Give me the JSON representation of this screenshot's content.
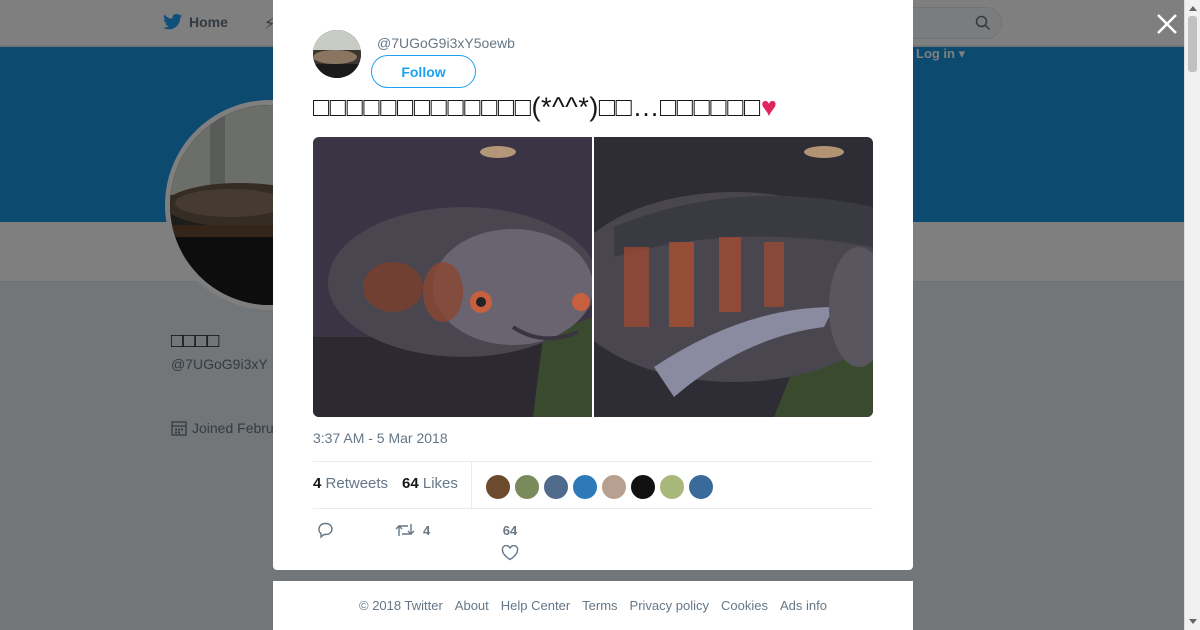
{
  "topbar": {
    "home_label": "Home",
    "login_label": "Log in ▾"
  },
  "profile": {
    "name": "□□□□",
    "handle": "@7UGoG9i3xY",
    "joined": "Joined Febru"
  },
  "tweet": {
    "handle": "@7UGoG9i3xY5oewb",
    "follow_label": "Follow",
    "text": "□□□□□□□□□□□□□(*^^*)□□…□□□□□□",
    "heart": "♥",
    "timestamp": "3:37 AM - 5 Mar 2018",
    "retweets_count": "4",
    "retweets_label": "Retweets",
    "likes_count": "64",
    "likes_label": "Likes",
    "reply_count": "",
    "retweet_action_count": "4",
    "like_action_count": "64",
    "liker_colors": [
      "#6b4a2e",
      "#7a8a5a",
      "#4f6a8a",
      "#2e7ab8",
      "#b8a090",
      "#111111",
      "#a8b87a",
      "#3a6a9a"
    ]
  },
  "footer": {
    "links": [
      "© 2018 Twitter",
      "About",
      "Help Center",
      "Terms",
      "Privacy policy",
      "Cookies",
      "Ads info"
    ]
  },
  "colors": {
    "brand_blue": "#1da1f2",
    "banner_blue": "#1b95e0",
    "like_pink": "#e0245e"
  },
  "icons": {
    "twitter": "bird-icon",
    "close": "close-icon",
    "search": "search-icon"
  }
}
